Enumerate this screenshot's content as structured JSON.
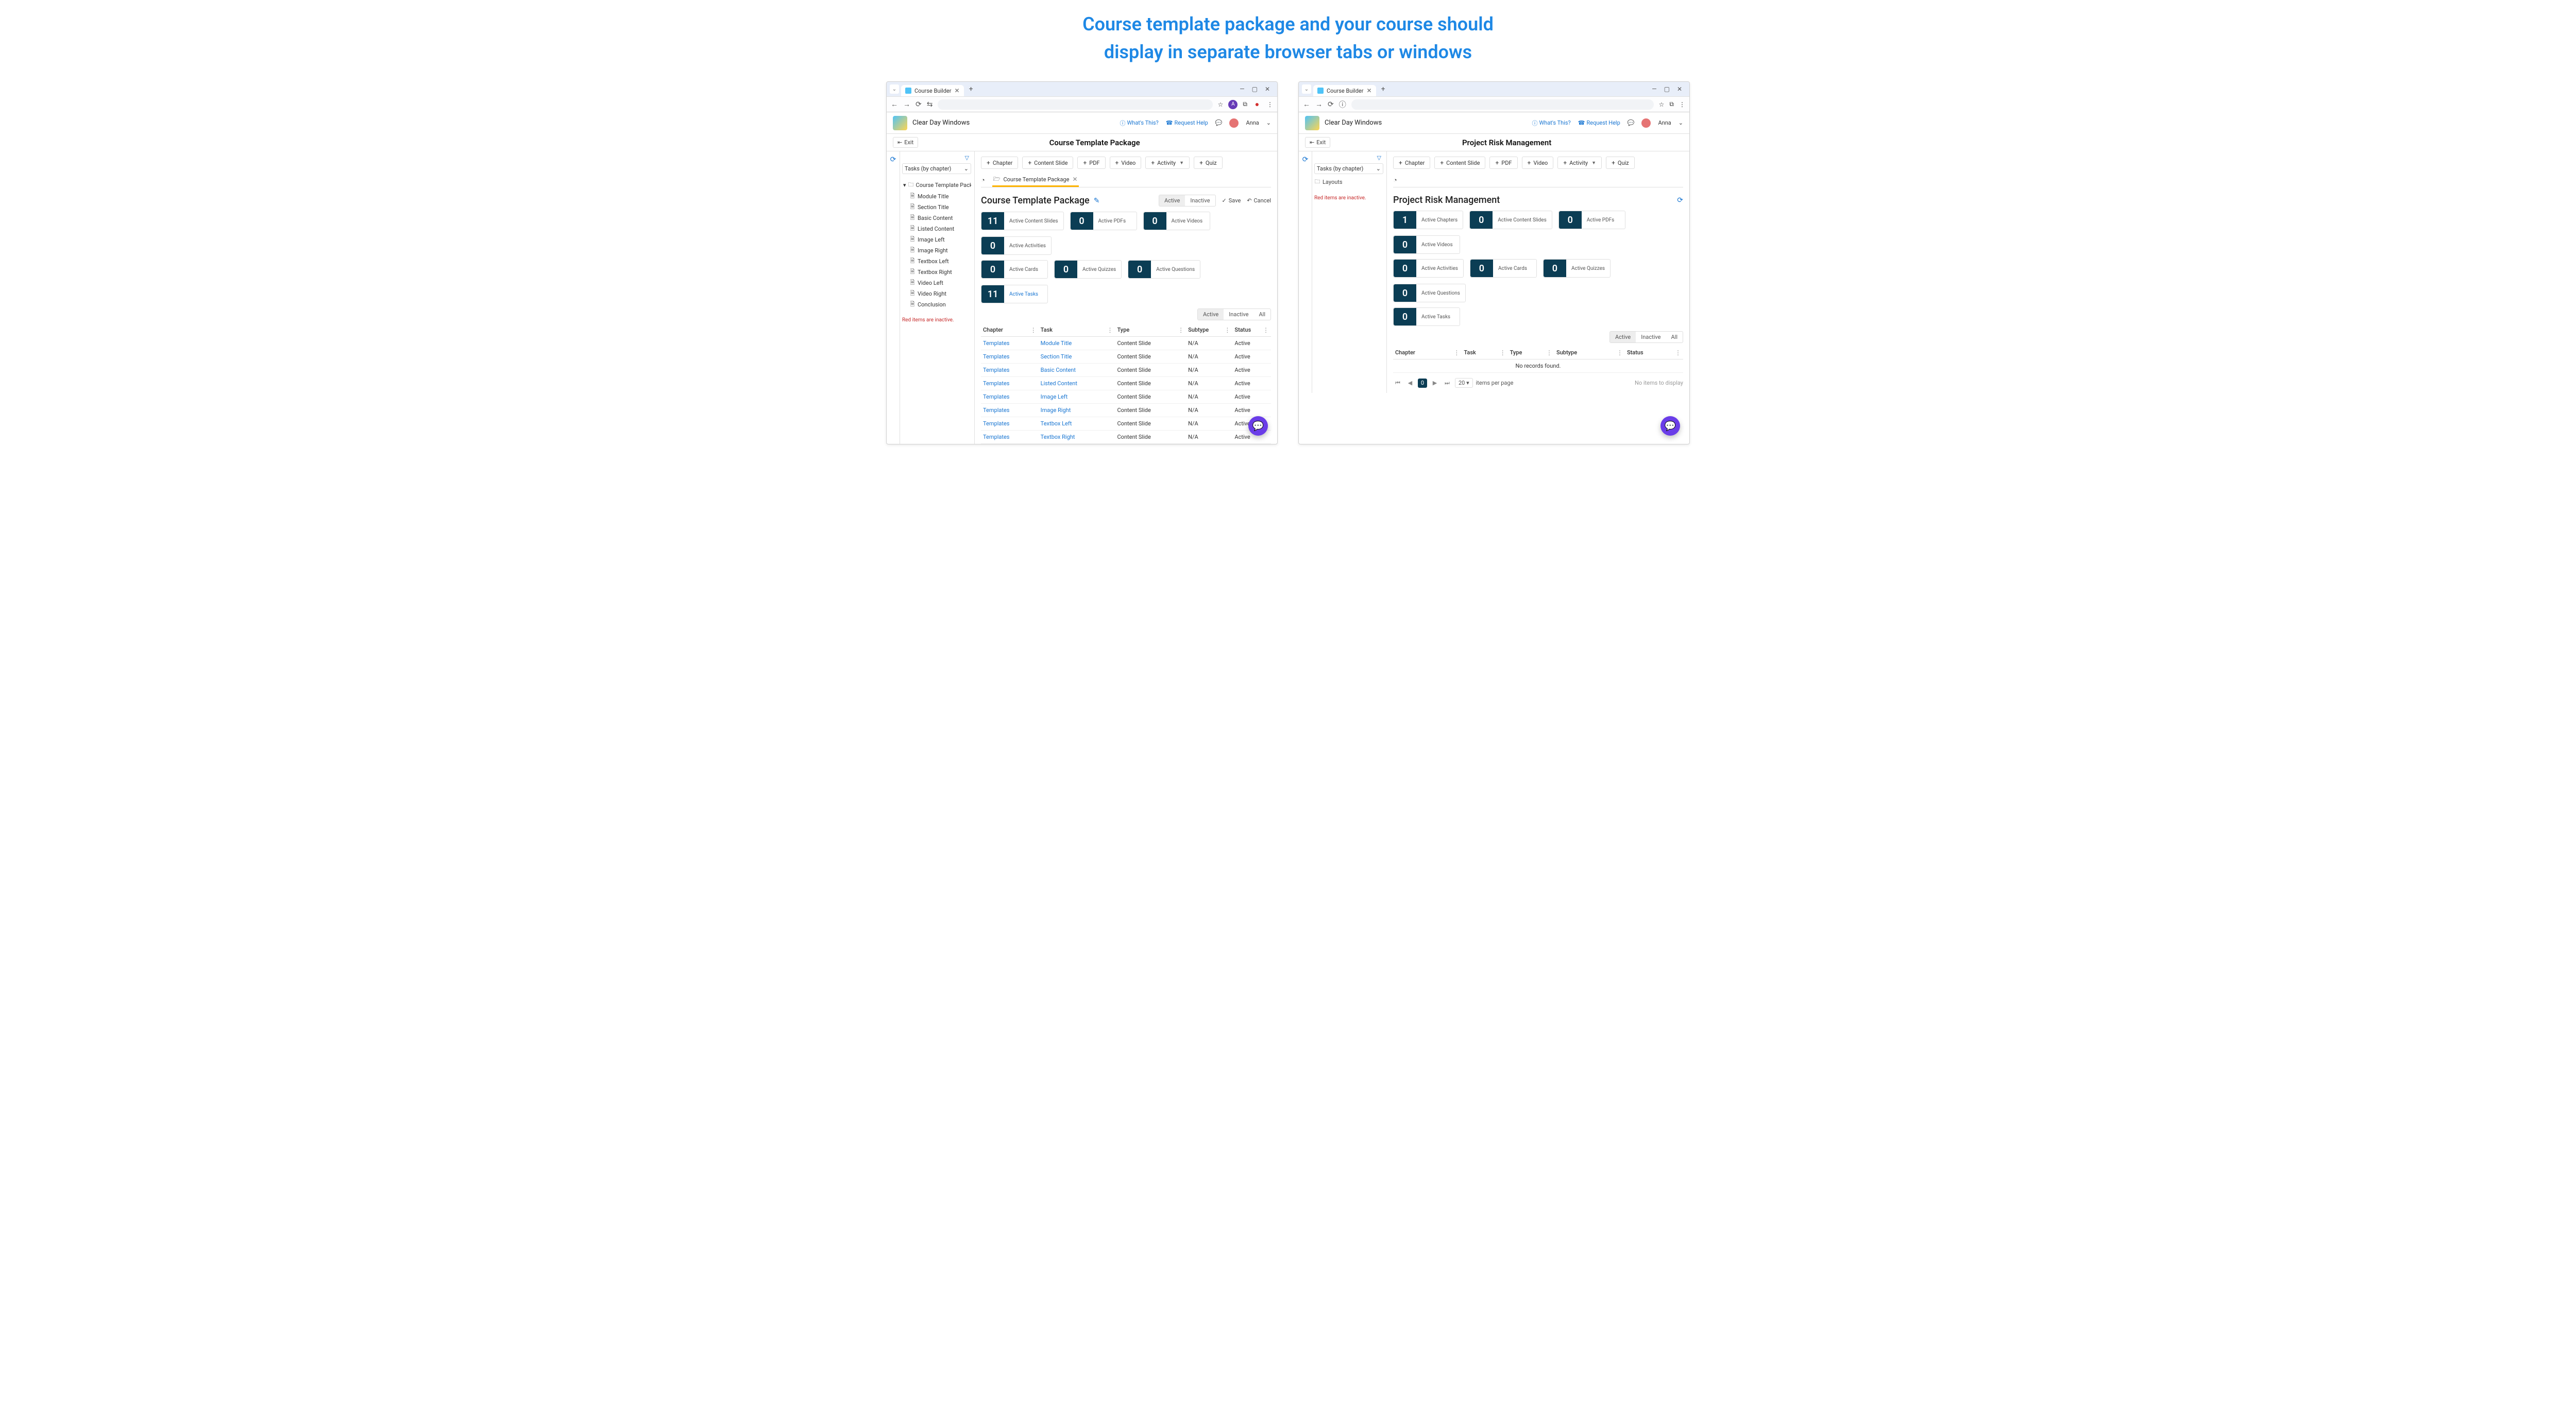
{
  "banner": {
    "line1": "Course template package and your course should",
    "line2": "display in separate browser tabs or windows"
  },
  "chrome": {
    "tab_title": "Course Builder",
    "back": "←",
    "fwd": "→",
    "reload": "⟳",
    "min": "—",
    "max": "▢",
    "close": "✕"
  },
  "app_header": {
    "brand": "Clear Day Windows",
    "whats_this": "What's This?",
    "request_help": "Request Help",
    "user": "Anna"
  },
  "exit": "Exit",
  "add_buttons": [
    {
      "label": "Chapter",
      "caret": false
    },
    {
      "label": "Content Slide",
      "caret": false
    },
    {
      "label": "PDF",
      "caret": false
    },
    {
      "label": "Video",
      "caret": false
    },
    {
      "label": "Activity",
      "caret": true
    },
    {
      "label": "Quiz",
      "caret": false
    }
  ],
  "sidebar": {
    "dropdown": "Tasks (by chapter)",
    "red_note": "Red items are inactive."
  },
  "seg": {
    "active": "Active",
    "inactive": "Inactive",
    "all": "All"
  },
  "actions": {
    "save": "Save",
    "cancel": "Cancel"
  },
  "table": {
    "cols": {
      "chapter": "Chapter",
      "task": "Task",
      "type": "Type",
      "subtype": "Subtype",
      "status": "Status"
    },
    "no_records": "No records found.",
    "items_per_page": "items per page",
    "page_size": "20",
    "cur_page": "0",
    "no_items": "No items to display"
  },
  "left": {
    "page_title": "Course Template Package",
    "crumb": "Course Template Package",
    "heading": "Course Template Package",
    "tree_root": "Course Template Package",
    "tree_children": [
      "Module Title",
      "Section Title",
      "Basic Content",
      "Listed Content",
      "Image Left",
      "Image Right",
      "Textbox Left",
      "Textbox Right",
      "Video Left",
      "Video Right",
      "Conclusion"
    ],
    "stats_row1": [
      {
        "n": "11",
        "l": "Active Content Slides"
      },
      {
        "n": "0",
        "l": "Active PDFs"
      },
      {
        "n": "0",
        "l": "Active Videos"
      },
      {
        "n": "0",
        "l": "Active Activities"
      }
    ],
    "stats_row2": [
      {
        "n": "0",
        "l": "Active Cards"
      },
      {
        "n": "0",
        "l": "Active Quizzes"
      },
      {
        "n": "0",
        "l": "Active Questions"
      },
      {
        "n": "11",
        "l": "Active Tasks",
        "link": true
      }
    ],
    "rows": [
      {
        "chapter": "Templates",
        "task": "Module Title",
        "type": "Content Slide",
        "subtype": "N/A",
        "status": "Active"
      },
      {
        "chapter": "Templates",
        "task": "Section Title",
        "type": "Content Slide",
        "subtype": "N/A",
        "status": "Active"
      },
      {
        "chapter": "Templates",
        "task": "Basic Content",
        "type": "Content Slide",
        "subtype": "N/A",
        "status": "Active"
      },
      {
        "chapter": "Templates",
        "task": "Listed Content",
        "type": "Content Slide",
        "subtype": "N/A",
        "status": "Active"
      },
      {
        "chapter": "Templates",
        "task": "Image Left",
        "type": "Content Slide",
        "subtype": "N/A",
        "status": "Active"
      },
      {
        "chapter": "Templates",
        "task": "Image Right",
        "type": "Content Slide",
        "subtype": "N/A",
        "status": "Active"
      },
      {
        "chapter": "Templates",
        "task": "Textbox Left",
        "type": "Content Slide",
        "subtype": "N/A",
        "status": "Active"
      },
      {
        "chapter": "Templates",
        "task": "Textbox Right",
        "type": "Content Slide",
        "subtype": "N/A",
        "status": "Active"
      }
    ]
  },
  "right": {
    "page_title": "Project Risk Management",
    "heading": "Project Risk Management",
    "layouts": "Layouts",
    "stats_row1": [
      {
        "n": "1",
        "l": "Active Chapters"
      },
      {
        "n": "0",
        "l": "Active Content Slides"
      },
      {
        "n": "0",
        "l": "Active PDFs"
      },
      {
        "n": "0",
        "l": "Active Videos"
      }
    ],
    "stats_row2": [
      {
        "n": "0",
        "l": "Active Activities"
      },
      {
        "n": "0",
        "l": "Active Cards"
      },
      {
        "n": "0",
        "l": "Active Quizzes"
      },
      {
        "n": "0",
        "l": "Active Questions"
      }
    ],
    "stats_row3": [
      {
        "n": "0",
        "l": "Active Tasks"
      }
    ]
  }
}
